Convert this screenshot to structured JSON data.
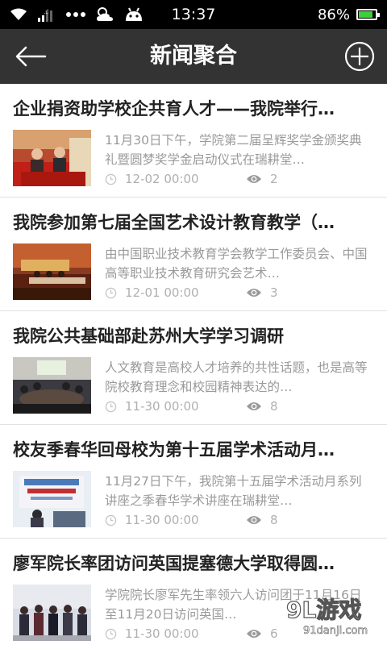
{
  "status_bar": {
    "time": "13:37",
    "battery_percent": "86%",
    "battery_level": 0.86,
    "icons": [
      "wifi-icon",
      "signal-icon",
      "more-dots-icon",
      "weather-icon",
      "android-icon",
      "battery-icon"
    ]
  },
  "header": {
    "title": "新闻聚合",
    "back_icon": "back-arrow-icon",
    "add_icon": "add-circle-icon"
  },
  "news": [
    {
      "title": "企业捐资助学校企共育人才——我院举行…",
      "summary": "11月30日下午，学院第二届呈辉奖学金颁奖典礼暨圆梦奖学金启动仪式在瑞耕堂…",
      "date": "12-02 00:00",
      "views": "2"
    },
    {
      "title": "我院参加第七届全国艺术设计教育教学（…",
      "summary": "由中国职业技术教育学会教学工作委员会、中国高等职业技术教育研究会艺术…",
      "date": "12-01 00:00",
      "views": "3"
    },
    {
      "title": "我院公共基础部赴苏州大学学习调研",
      "summary": "人文教育是高校人才培养的共性话题，也是高等院校教育理念和校园精神表达的…",
      "date": "11-30 00:00",
      "views": "8"
    },
    {
      "title": "校友季春华回母校为第十五届学术活动月…",
      "summary": "11月27日下午，我院第十五届学术活动月系列讲座之季春华学术讲座在瑞耕堂…",
      "date": "11-30 00:00",
      "views": "8"
    },
    {
      "title": "廖军院长率团访问英国提塞德大学取得圆…",
      "summary": "学院院长廖军先生率领六人访问团于11月16日至11月20日访问英国…",
      "date": "11-30 00:00",
      "views": "6"
    }
  ],
  "watermark": {
    "brand": "9L游戏",
    "site": "91danji.com"
  }
}
